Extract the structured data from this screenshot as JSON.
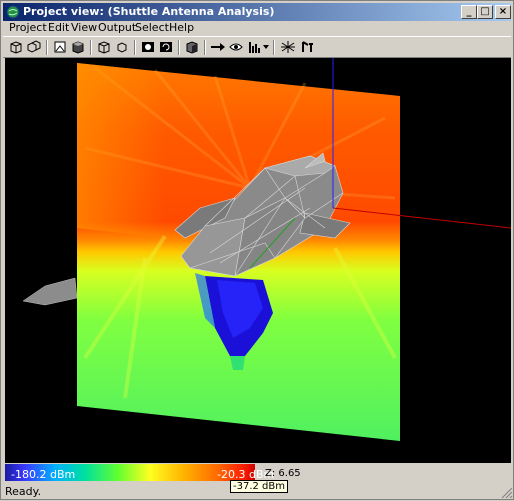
{
  "window": {
    "title": "Project view: (Shuttle Antenna Analysis)"
  },
  "window_controls": {
    "minimize": "_",
    "maximize": "□",
    "close": "×"
  },
  "menu": [
    {
      "label": "Project"
    },
    {
      "label": "Edit"
    },
    {
      "label": "View"
    },
    {
      "label": "Output"
    },
    {
      "label": "Select"
    },
    {
      "label": "Help"
    }
  ],
  "toolbar": {
    "buttons": [
      {
        "icon": "box-view-icon"
      },
      {
        "icon": "multi-box-view-icon"
      },
      {
        "icon": "picture-icon"
      },
      {
        "icon": "solid-box-icon"
      },
      {
        "icon": "wire-box-icon"
      },
      {
        "icon": "transparent-box-icon"
      },
      {
        "icon": "render-icon"
      },
      {
        "icon": "rotate-render-icon"
      },
      {
        "icon": "cube-icon"
      },
      {
        "icon": "arrow-right-icon"
      },
      {
        "icon": "eye-icon"
      },
      {
        "icon": "antenna-array-icon"
      },
      {
        "icon": "radiate-icon"
      },
      {
        "icon": "receiver-icon"
      }
    ]
  },
  "status": {
    "legend_min": "-180.2 dBm",
    "legend_max": "-20.3 dBm",
    "z_readout": "Z: 6.65",
    "tooltip": "-37.2 dBm",
    "ready": "Ready."
  },
  "colors": {
    "titlebar_start": "#0a246a",
    "titlebar_end": "#a6caf0",
    "viewport_bg": "#000000"
  }
}
